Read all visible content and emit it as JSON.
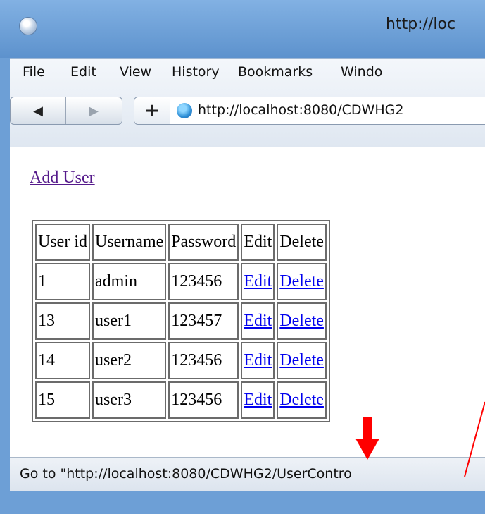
{
  "window": {
    "title": "http://loc"
  },
  "menubar": {
    "items": [
      {
        "label": "File"
      },
      {
        "label": "Edit"
      },
      {
        "label": "View"
      },
      {
        "label": "History"
      },
      {
        "label": "Bookmarks"
      },
      {
        "label": "Windo"
      }
    ]
  },
  "navbar": {
    "back_glyph": "◀",
    "forward_glyph": "▶",
    "add_glyph": "+",
    "url": "http://localhost:8080/CDWHG2"
  },
  "page": {
    "add_user_link": "Add User",
    "table": {
      "headers": [
        "User id",
        "Username",
        "Password",
        "Edit",
        "Delete"
      ],
      "rows": [
        {
          "id": "1",
          "username": "admin",
          "password": "123456",
          "edit": "Edit",
          "delete": "Delete"
        },
        {
          "id": "13",
          "username": "user1",
          "password": "123457",
          "edit": "Edit",
          "delete": "Delete"
        },
        {
          "id": "14",
          "username": "user2",
          "password": "123456",
          "edit": "Edit",
          "delete": "Delete"
        },
        {
          "id": "15",
          "username": "user3",
          "password": "123456",
          "edit": "Edit",
          "delete": "Delete"
        }
      ]
    }
  },
  "status_bar": {
    "text": "Go to \"http://localhost:8080/CDWHG2/UserContro"
  },
  "colors": {
    "frame_blue": "#6d9fd6",
    "visited_link": "#551a8b",
    "link": "#0000ee",
    "annotation_red": "#ff0000"
  }
}
